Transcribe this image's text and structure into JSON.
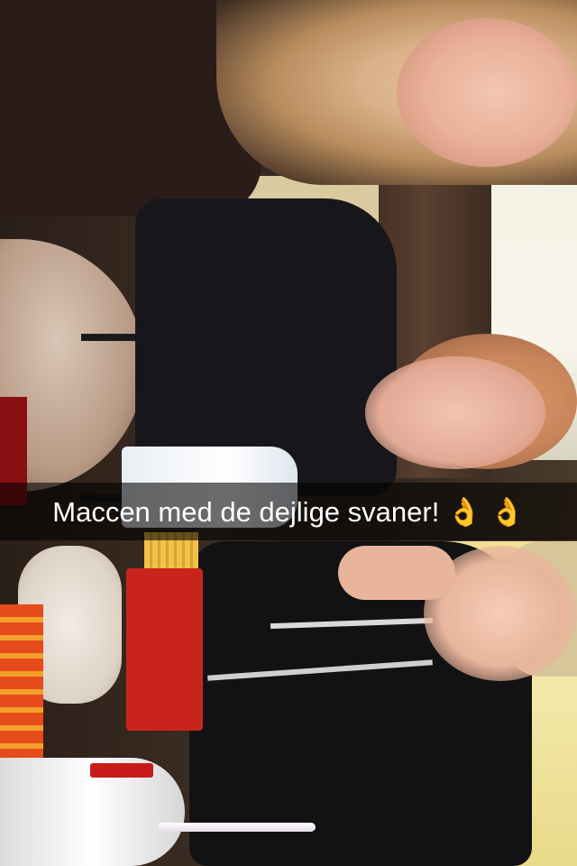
{
  "caption": {
    "text": "Maccen med de dejlige svaner! 👌 👌"
  },
  "colors": {
    "caption_bar_bg": "rgba(0,0,0,0.58)",
    "caption_text": "#ffffff"
  }
}
